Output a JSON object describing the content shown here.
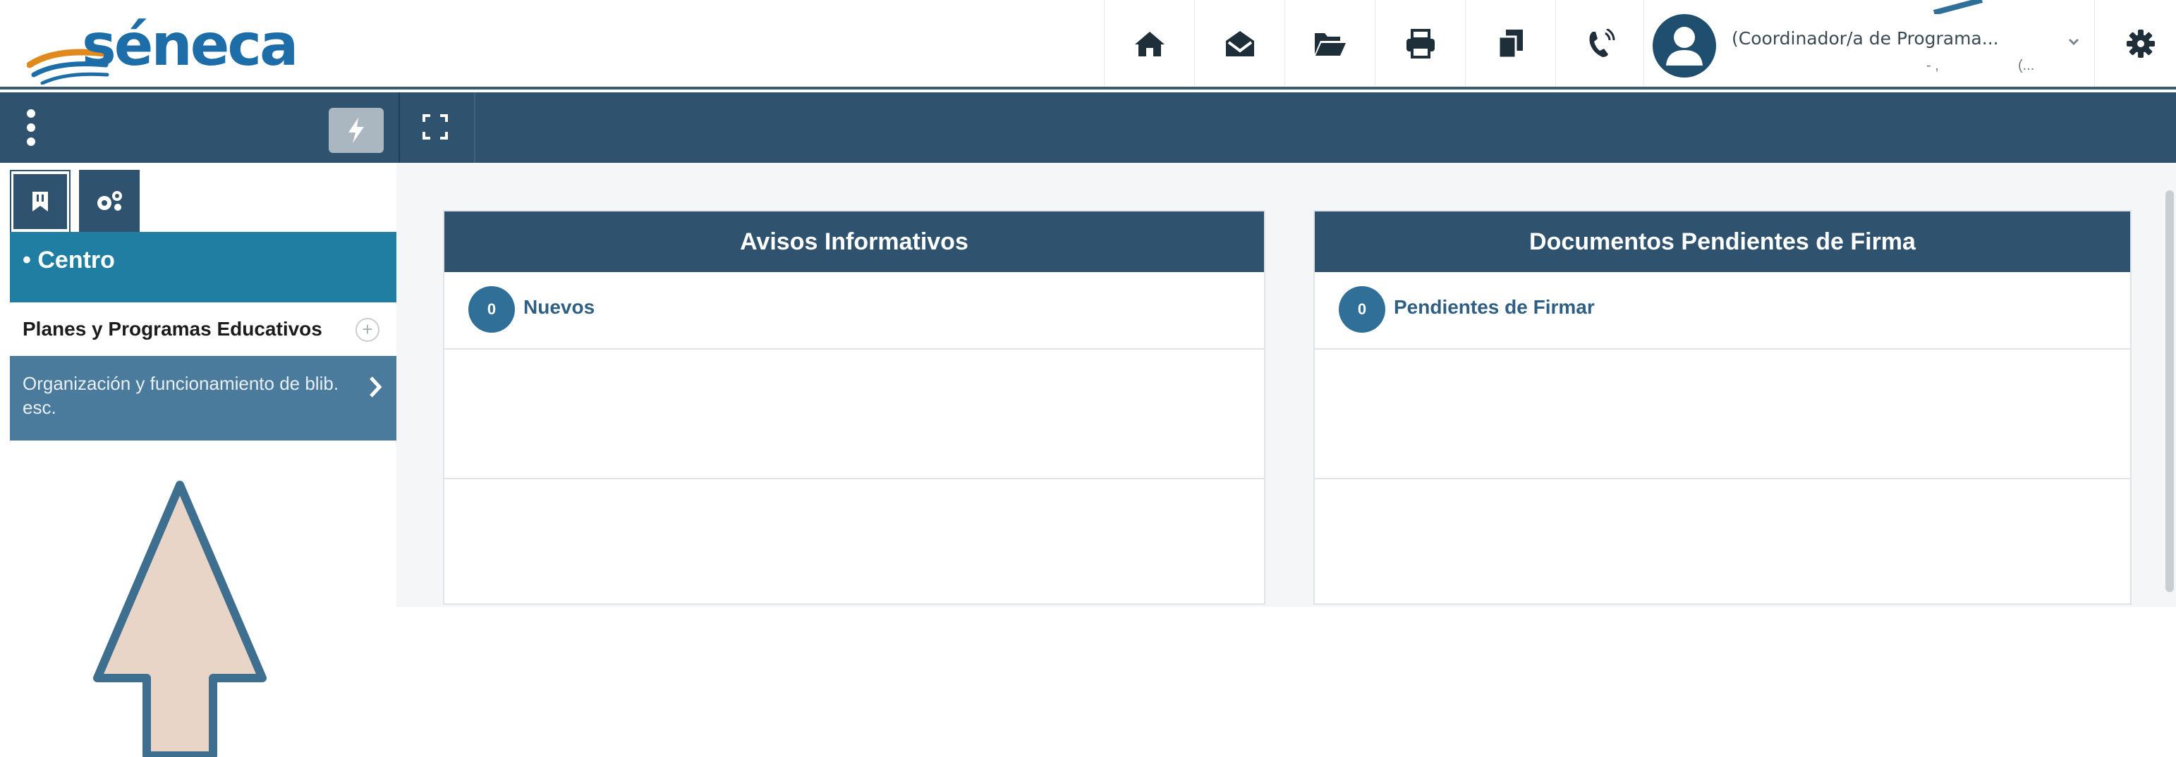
{
  "header": {
    "logo_text": "séneca",
    "user_role": "(Coordinador/a de Programa...",
    "user_sub_left": "- ,",
    "user_sub_right": "(..."
  },
  "sidebar": {
    "centro_label": "• Centro",
    "items": [
      {
        "label": "Planes y Programas Educativos"
      },
      {
        "label": "Organización y funcionamiento de blib. esc."
      }
    ]
  },
  "panels": [
    {
      "title": "Avisos Informativos",
      "count": "0",
      "label": "Nuevos"
    },
    {
      "title": "Documentos Pendientes de Firma",
      "count": "0",
      "label": "Pendientes de Firmar"
    }
  ],
  "colors": {
    "header_bar": "#2f536e",
    "centro_bg": "#1f7ea1",
    "org_bg": "#4a7a9c",
    "badge": "#2f6f98",
    "arrow_fill": "#e8d5c8",
    "arrow_stroke": "#3f6f8f"
  },
  "icons": [
    "home-icon",
    "envelope-open-icon",
    "folder-open-icon",
    "print-icon",
    "copy-icon",
    "phone-volume-icon",
    "user-avatar-icon",
    "gear-icon",
    "ellipsis-vertical-icon",
    "bolt-icon",
    "expand-icon",
    "bookmark-icon",
    "cogs-icon",
    "plus-circle-icon",
    "chevron-right-icon",
    "arrow-up-annotation"
  ]
}
